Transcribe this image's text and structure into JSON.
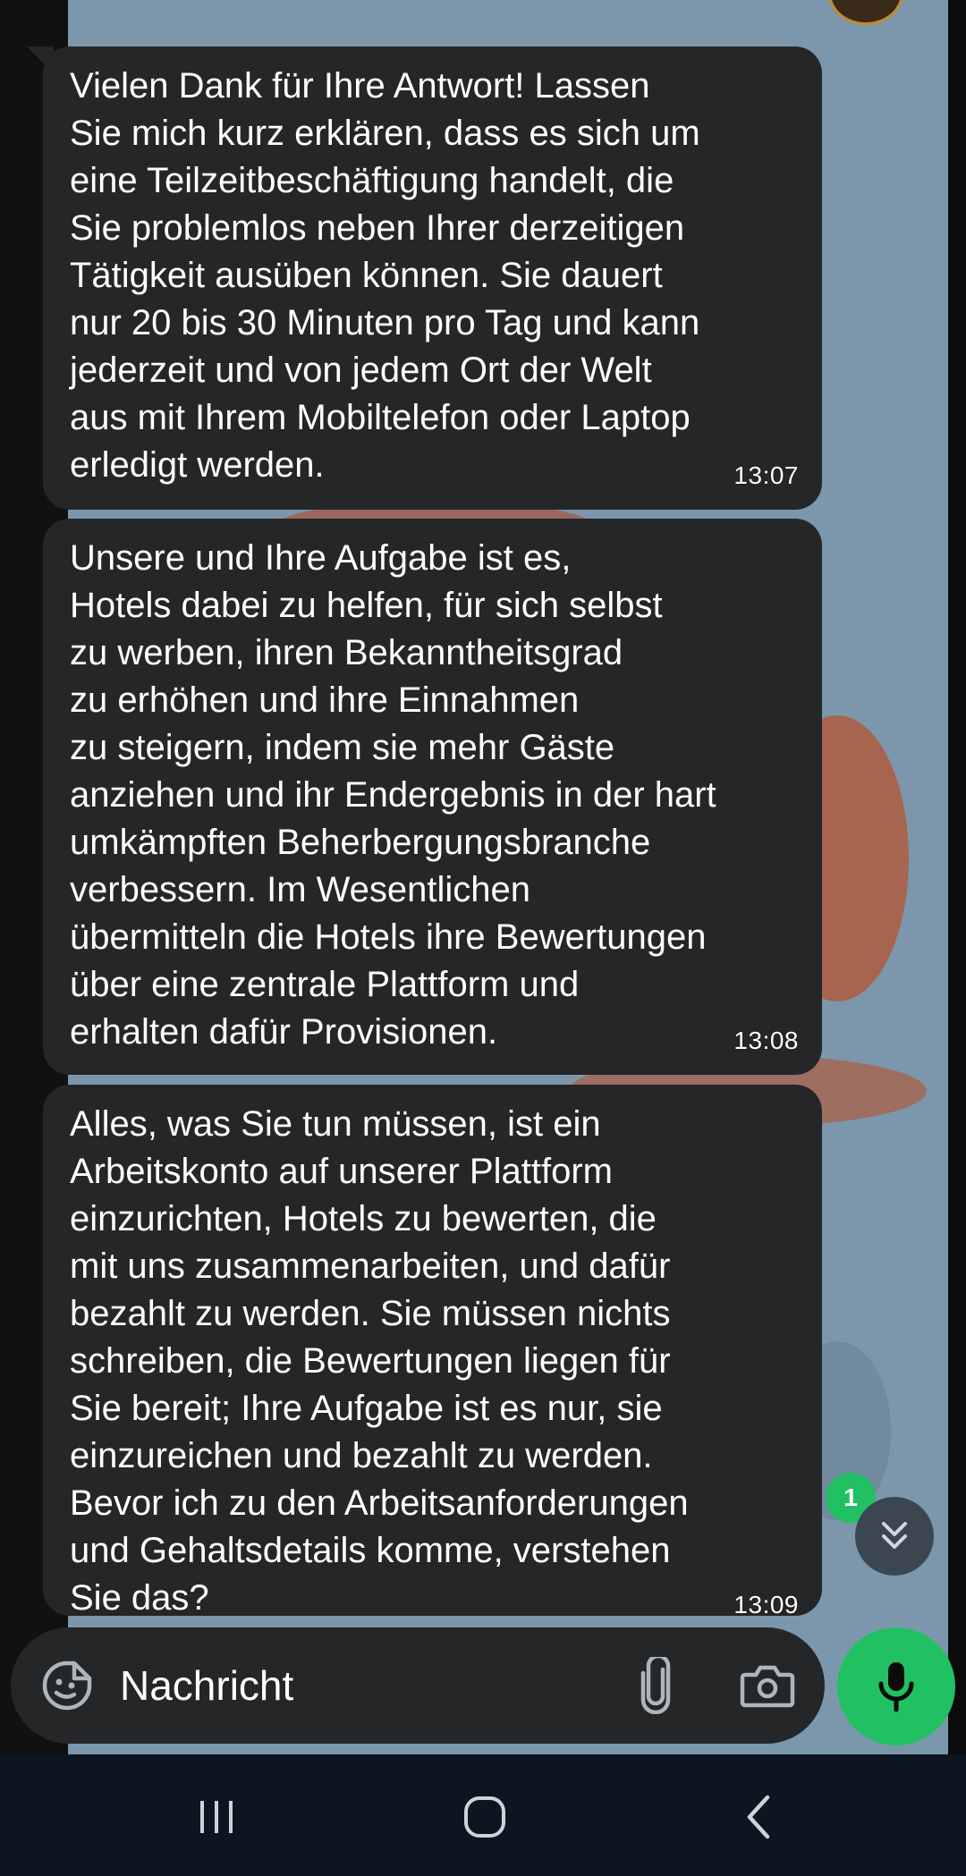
{
  "messages": [
    {
      "text": "Vielen Dank für Ihre Antwort! Lassen\nSie mich kurz erklären, dass es sich um\neine Teilzeitbeschäftigung handelt, die\nSie problemlos neben Ihrer derzeitigen\nTätigkeit ausüben können. Sie dauert\nnur 20 bis 30 Minuten pro Tag und kann\njederzeit und von jedem Ort der Welt\naus mit Ihrem Mobiltelefon oder Laptop\nerledigt werden.",
      "time": "13:07"
    },
    {
      "text": "Unsere und Ihre Aufgabe ist es,\nHotels dabei zu helfen, für sich selbst\nzu werben, ihren Bekanntheitsgrad\nzu erhöhen und ihre Einnahmen\nzu steigern, indem sie mehr Gäste\nanziehen und ihr Endergebnis in der hart\numkämpften Beherbergungsbranche\nverbessern. Im Wesentlichen\nübermitteln die Hotels ihre Bewertungen\nüber eine zentrale Plattform und\nerhalten dafür Provisionen.",
      "time": "13:08"
    },
    {
      "text": "Alles, was Sie tun müssen, ist ein\nArbeitskonto auf unserer Plattform\neinzurichten, Hotels zu bewerten, die\nmit uns zusammenarbeiten, und dafür\nbezahlt zu werden. Sie müssen nichts\nschreiben, die Bewertungen liegen für\nSie bereit; Ihre Aufgabe ist es nur, sie\neinzureichen und bezahlt zu werden.\nBevor ich zu den Arbeitsanforderungen\nund Gehaltsdetails komme, verstehen\nSie das?",
      "time": "13:09"
    }
  ],
  "scroll_down": {
    "unread_count": "1",
    "icon": "double-chevron-down-icon"
  },
  "composer": {
    "placeholder": "Nachricht",
    "icons": [
      "sticker-icon",
      "paperclip-icon",
      "camera-icon",
      "microphone-icon"
    ]
  },
  "navbar": {
    "icons": [
      "recent-apps-icon",
      "home-icon",
      "back-icon"
    ]
  },
  "colors": {
    "wallpaper": "#7c97ac",
    "bubble": "#242628",
    "accent": "#21c063",
    "navbar": "#0d1521"
  }
}
